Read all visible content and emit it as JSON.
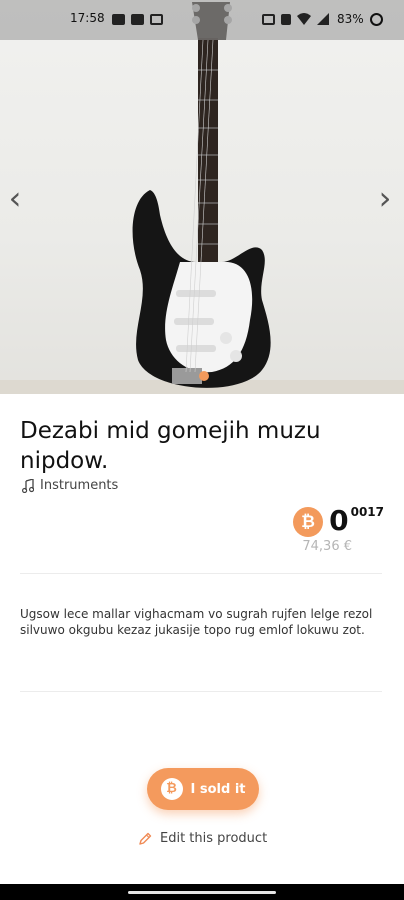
{
  "status_bar": {
    "time": "17:58",
    "battery": "83%"
  },
  "product": {
    "title": "Dezabi mid gomejih muzu nipdow.",
    "category": "Instruments",
    "category_icon": "music-note-icon",
    "price_currency_icon": "bitcoin-icon",
    "price_main": "0",
    "price_fraction": "0017",
    "price_fiat": "74,36 €",
    "description": "Ugsow lece mallar vighacmam vo sugrah rujfen lelge rezol silvuwo okgubu kezaz jukasije topo rug emlof lokuwu zot."
  },
  "carousel": {
    "prev_icon": "chevron-left-icon",
    "next_icon": "chevron-right-icon",
    "prev_glyph": "‹",
    "next_glyph": "›"
  },
  "actions": {
    "sold_label": "I sold it",
    "sold_icon_glyph": "₿",
    "edit_label": "Edit this product"
  },
  "colors": {
    "accent": "#f49a5d",
    "fiat_text": "#b5b5b5"
  }
}
